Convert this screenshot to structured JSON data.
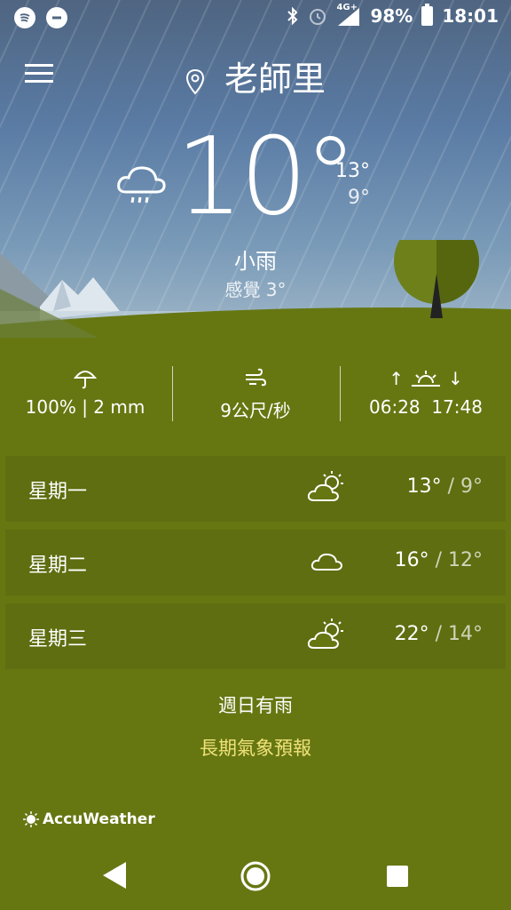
{
  "status_bar": {
    "left_icons": [
      "spotify-icon",
      "do-not-disturb-icon"
    ],
    "right_icons": [
      "bluetooth-icon",
      "alarm-icon",
      "signal-icon"
    ],
    "network": "4G+",
    "battery": "98%",
    "time": "18:01"
  },
  "header": {
    "location": "老師里"
  },
  "current": {
    "temperature": "10°",
    "high": "13°",
    "low": "9°",
    "condition": "小雨",
    "feels_like": "感覺 3°",
    "condition_icon": "rain-cloud-icon"
  },
  "stats": {
    "precipitation": "100% | 2 mm",
    "wind": "9公尺/秒",
    "sunrise": "06:28",
    "sunset": "17:48"
  },
  "forecast": [
    {
      "day": "星期一",
      "icon": "partly-sunny-icon",
      "high": "13°",
      "low": "9°"
    },
    {
      "day": "星期二",
      "icon": "cloud-icon",
      "high": "16°",
      "low": "12°"
    },
    {
      "day": "星期三",
      "icon": "partly-sunny-icon",
      "high": "22°",
      "low": "14°"
    }
  ],
  "weekend_note": "週日有雨",
  "long_term_link": "長期氣象預報",
  "brand": "AccuWeather",
  "colors": {
    "ground": "#667712",
    "link": "#f1e27a",
    "sky_top": "#4f6581"
  }
}
